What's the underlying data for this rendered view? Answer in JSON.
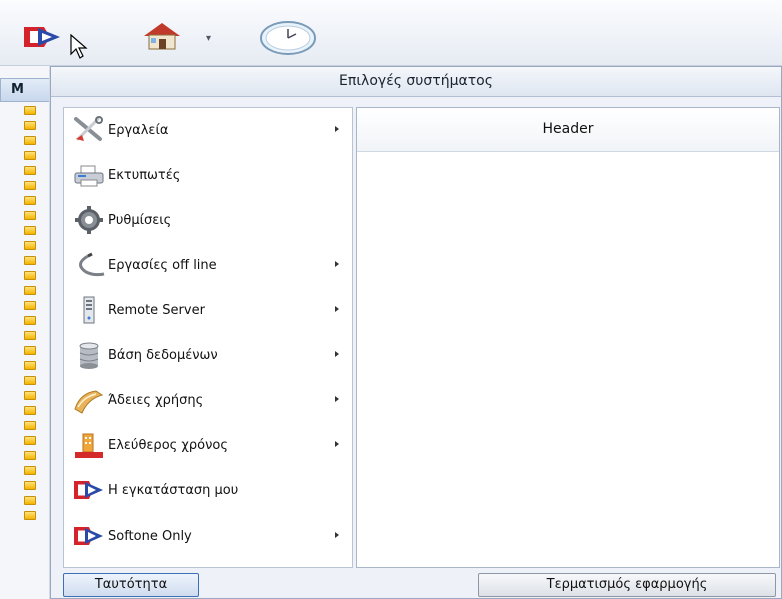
{
  "toolbar": {
    "icons": [
      "softone-logo-icon",
      "house-icon",
      "clock-icon"
    ],
    "dropdown_glyph": "▾"
  },
  "background_app": {
    "tab_label": "M"
  },
  "dialog": {
    "title": "Επιλογές συστήματος",
    "menu_items": [
      {
        "label": "Εργαλεία",
        "icon": "tools-icon",
        "has_submenu": true
      },
      {
        "label": "Εκτυπωτές",
        "icon": "printer-icon",
        "has_submenu": false
      },
      {
        "label": "Ρυθμίσεις",
        "icon": "gear-icon",
        "has_submenu": false
      },
      {
        "label": "Εργασίες off line",
        "icon": "cable-icon",
        "has_submenu": true
      },
      {
        "label": "Remote Server",
        "icon": "server-icon",
        "has_submenu": true
      },
      {
        "label": "Βάση δεδομένων",
        "icon": "database-icon",
        "has_submenu": true
      },
      {
        "label": "Άδειες χρήσης",
        "icon": "license-icon",
        "has_submenu": true
      },
      {
        "label": "Ελεύθερος χρόνος",
        "icon": "free-time-icon",
        "has_submenu": true
      },
      {
        "label": "Η εγκατάσταση μου",
        "icon": "softone-logo-icon",
        "has_submenu": false
      },
      {
        "label": "Softone Only",
        "icon": "softone-logo-icon",
        "has_submenu": true
      }
    ],
    "panel_header": "Header",
    "identity_button": "Ταυτότητα",
    "exit_button": "Τερματισμός εφαρμογής"
  },
  "colors": {
    "accent_blue": "#3d6fb5",
    "logo_red": "#d4232b",
    "logo_blue": "#2b4aa8"
  }
}
